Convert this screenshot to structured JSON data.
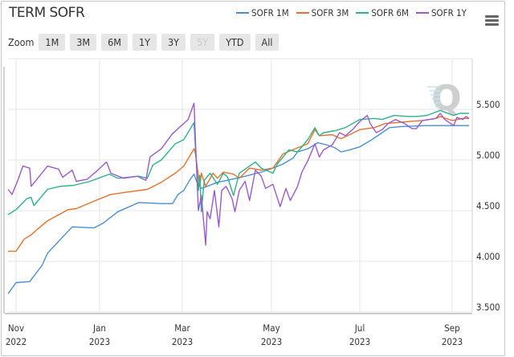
{
  "chart_data": {
    "type": "line",
    "title": "TERM SOFR",
    "watermark": "Q",
    "ylim": [
      3.5,
      6.0
    ],
    "y_ticks": [
      "3.500",
      "4.000",
      "4.500",
      "5.000",
      "5.500"
    ],
    "y_tick_values": [
      3.5,
      4.0,
      4.5,
      5.0,
      5.5
    ],
    "x_ticks": [
      {
        "date": "2022-11-01",
        "month": "Nov",
        "year": "2022"
      },
      {
        "date": "2023-01-01",
        "month": "Jan",
        "year": "2023"
      },
      {
        "date": "2023-03-01",
        "month": "Mar",
        "year": "2023"
      },
      {
        "date": "2023-05-01",
        "month": "May",
        "year": "2023"
      },
      {
        "date": "2023-07-01",
        "month": "Jul",
        "year": "2023"
      },
      {
        "date": "2023-09-01",
        "month": "Sep",
        "year": "2023"
      }
    ],
    "grid": true,
    "legend_position": "top-right",
    "series": [
      {
        "name": "SOFR 1M",
        "color": "#4a8fd6",
        "points": [
          [
            "2022-10-26",
            3.68
          ],
          [
            "2022-11-01",
            3.79
          ],
          [
            "2022-11-11",
            3.8
          ],
          [
            "2022-11-20",
            3.96
          ],
          [
            "2022-11-24",
            4.08
          ],
          [
            "2022-12-05",
            4.24
          ],
          [
            "2022-12-12",
            4.34
          ],
          [
            "2022-12-28",
            4.33
          ],
          [
            "2023-01-04",
            4.38
          ],
          [
            "2023-01-14",
            4.49
          ],
          [
            "2023-01-29",
            4.58
          ],
          [
            "2023-02-14",
            4.57
          ],
          [
            "2023-02-22",
            4.57
          ],
          [
            "2023-02-26",
            4.66
          ],
          [
            "2023-03-02",
            4.7
          ],
          [
            "2023-03-06",
            4.8
          ],
          [
            "2023-03-09",
            4.86
          ],
          [
            "2023-03-11",
            4.78
          ],
          [
            "2023-03-14",
            4.72
          ],
          [
            "2023-03-18",
            4.74
          ],
          [
            "2023-03-25",
            4.78
          ],
          [
            "2023-04-01",
            4.8
          ],
          [
            "2023-04-13",
            4.84
          ],
          [
            "2023-04-24",
            4.88
          ],
          [
            "2023-05-02",
            4.92
          ],
          [
            "2023-05-09",
            4.96
          ],
          [
            "2023-05-16",
            5.02
          ],
          [
            "2023-05-19",
            5.08
          ],
          [
            "2023-05-26",
            5.11
          ],
          [
            "2023-06-02",
            5.17
          ],
          [
            "2023-06-08",
            5.15
          ],
          [
            "2023-06-14",
            5.12
          ],
          [
            "2023-06-18",
            5.08
          ],
          [
            "2023-06-24",
            5.1
          ],
          [
            "2023-07-01",
            5.13
          ],
          [
            "2023-07-09",
            5.2
          ],
          [
            "2023-07-16",
            5.27
          ],
          [
            "2023-07-21",
            5.32
          ],
          [
            "2023-07-29",
            5.33
          ],
          [
            "2023-08-15",
            5.34
          ],
          [
            "2023-09-04",
            5.34
          ],
          [
            "2023-09-12",
            5.34
          ]
        ]
      },
      {
        "name": "SOFR 3M",
        "color": "#e8702a",
        "points": [
          [
            "2022-10-26",
            4.1
          ],
          [
            "2022-11-01",
            4.1
          ],
          [
            "2022-11-07",
            4.22
          ],
          [
            "2022-11-12",
            4.26
          ],
          [
            "2022-11-16",
            4.31
          ],
          [
            "2022-11-24",
            4.4
          ],
          [
            "2022-12-09",
            4.51
          ],
          [
            "2022-12-15",
            4.52
          ],
          [
            "2022-12-29",
            4.6
          ],
          [
            "2023-01-09",
            4.66
          ],
          [
            "2023-01-19",
            4.68
          ],
          [
            "2023-02-04",
            4.71
          ],
          [
            "2023-02-14",
            4.78
          ],
          [
            "2023-02-24",
            4.87
          ],
          [
            "2023-03-02",
            4.94
          ],
          [
            "2023-03-09",
            5.11
          ],
          [
            "2023-03-10",
            5.06
          ],
          [
            "2023-03-13",
            4.74
          ],
          [
            "2023-03-14",
            4.87
          ],
          [
            "2023-03-17",
            4.74
          ],
          [
            "2023-03-22",
            4.87
          ],
          [
            "2023-03-25",
            4.82
          ],
          [
            "2023-03-29",
            4.88
          ],
          [
            "2023-04-05",
            4.86
          ],
          [
            "2023-04-09",
            4.82
          ],
          [
            "2023-04-16",
            4.92
          ],
          [
            "2023-04-24",
            4.9
          ],
          [
            "2023-05-02",
            4.92
          ],
          [
            "2023-05-09",
            5.06
          ],
          [
            "2023-05-19",
            5.12
          ],
          [
            "2023-05-26",
            5.16
          ],
          [
            "2023-05-31",
            5.3
          ],
          [
            "2023-06-03",
            5.24
          ],
          [
            "2023-06-12",
            5.25
          ],
          [
            "2023-06-18",
            5.21
          ],
          [
            "2023-06-24",
            5.25
          ],
          [
            "2023-07-01",
            5.3
          ],
          [
            "2023-07-11",
            5.32
          ],
          [
            "2023-07-18",
            5.36
          ],
          [
            "2023-07-26",
            5.37
          ],
          [
            "2023-08-03",
            5.38
          ],
          [
            "2023-08-12",
            5.39
          ],
          [
            "2023-08-21",
            5.41
          ],
          [
            "2023-08-24",
            5.43
          ],
          [
            "2023-09-01",
            5.39
          ],
          [
            "2023-09-08",
            5.41
          ],
          [
            "2023-09-12",
            5.41
          ]
        ]
      },
      {
        "name": "SOFR 6M",
        "color": "#2bb38a",
        "points": [
          [
            "2022-10-26",
            4.46
          ],
          [
            "2022-11-01",
            4.51
          ],
          [
            "2022-11-09",
            4.62
          ],
          [
            "2022-11-12",
            4.63
          ],
          [
            "2022-11-14",
            4.55
          ],
          [
            "2022-11-24",
            4.71
          ],
          [
            "2022-12-03",
            4.74
          ],
          [
            "2022-12-13",
            4.75
          ],
          [
            "2022-12-25",
            4.79
          ],
          [
            "2023-01-08",
            4.86
          ],
          [
            "2023-01-14",
            4.82
          ],
          [
            "2023-01-29",
            4.84
          ],
          [
            "2023-02-04",
            4.82
          ],
          [
            "2023-02-08",
            4.95
          ],
          [
            "2023-02-14",
            5.0
          ],
          [
            "2023-02-24",
            5.16
          ],
          [
            "2023-03-02",
            5.2
          ],
          [
            "2023-03-09",
            5.37
          ],
          [
            "2023-03-10",
            5.11
          ],
          [
            "2023-03-12",
            4.7
          ],
          [
            "2023-03-13",
            4.85
          ],
          [
            "2023-03-14",
            4.49
          ],
          [
            "2023-03-16",
            4.8
          ],
          [
            "2023-03-20",
            4.87
          ],
          [
            "2023-03-25",
            4.76
          ],
          [
            "2023-03-29",
            4.87
          ],
          [
            "2023-04-01",
            4.83
          ],
          [
            "2023-04-05",
            4.65
          ],
          [
            "2023-04-09",
            4.87
          ],
          [
            "2023-04-14",
            4.92
          ],
          [
            "2023-04-20",
            4.98
          ],
          [
            "2023-04-24",
            4.92
          ],
          [
            "2023-05-02",
            4.87
          ],
          [
            "2023-05-05",
            4.96
          ],
          [
            "2023-05-13",
            5.1
          ],
          [
            "2023-05-19",
            5.08
          ],
          [
            "2023-05-26",
            5.2
          ],
          [
            "2023-05-31",
            5.32
          ],
          [
            "2023-06-03",
            5.24
          ],
          [
            "2023-06-06",
            5.27
          ],
          [
            "2023-06-14",
            5.29
          ],
          [
            "2023-06-21",
            5.32
          ],
          [
            "2023-07-01",
            5.4
          ],
          [
            "2023-07-11",
            5.41
          ],
          [
            "2023-07-16",
            5.4
          ],
          [
            "2023-07-24",
            5.44
          ],
          [
            "2023-08-02",
            5.43
          ],
          [
            "2023-08-08",
            5.43
          ],
          [
            "2023-08-15",
            5.44
          ],
          [
            "2023-08-24",
            5.49
          ],
          [
            "2023-09-02",
            5.44
          ],
          [
            "2023-09-06",
            5.46
          ],
          [
            "2023-09-12",
            5.46
          ]
        ]
      },
      {
        "name": "SOFR 1Y",
        "color": "#9b59d0",
        "points": [
          [
            "2022-10-26",
            4.71
          ],
          [
            "2022-10-29",
            4.66
          ],
          [
            "2022-11-02",
            4.79
          ],
          [
            "2022-11-06",
            4.94
          ],
          [
            "2022-11-11",
            4.92
          ],
          [
            "2022-11-12",
            4.74
          ],
          [
            "2022-11-18",
            4.84
          ],
          [
            "2022-11-24",
            4.94
          ],
          [
            "2022-12-02",
            4.91
          ],
          [
            "2022-12-05",
            4.83
          ],
          [
            "2022-12-12",
            4.9
          ],
          [
            "2022-12-15",
            4.79
          ],
          [
            "2022-12-23",
            4.81
          ],
          [
            "2022-12-29",
            4.88
          ],
          [
            "2023-01-06",
            4.98
          ],
          [
            "2023-01-09",
            4.87
          ],
          [
            "2023-01-18",
            4.82
          ],
          [
            "2023-01-28",
            4.84
          ],
          [
            "2023-02-03",
            4.8
          ],
          [
            "2023-02-06",
            5.03
          ],
          [
            "2023-02-14",
            5.11
          ],
          [
            "2023-02-22",
            5.26
          ],
          [
            "2023-03-05",
            5.4
          ],
          [
            "2023-03-09",
            5.56
          ],
          [
            "2023-03-10",
            5.19
          ],
          [
            "2023-03-12",
            4.5
          ],
          [
            "2023-03-14",
            4.65
          ],
          [
            "2023-03-17",
            4.16
          ],
          [
            "2023-03-18",
            4.49
          ],
          [
            "2023-03-20",
            4.42
          ],
          [
            "2023-03-23",
            4.7
          ],
          [
            "2023-03-26",
            4.34
          ],
          [
            "2023-03-28",
            4.7
          ],
          [
            "2023-03-31",
            4.74
          ],
          [
            "2023-04-04",
            4.62
          ],
          [
            "2023-04-06",
            4.49
          ],
          [
            "2023-04-09",
            4.7
          ],
          [
            "2023-04-13",
            4.79
          ],
          [
            "2023-04-16",
            4.6
          ],
          [
            "2023-04-20",
            4.9
          ],
          [
            "2023-04-24",
            4.84
          ],
          [
            "2023-04-27",
            4.72
          ],
          [
            "2023-05-02",
            4.76
          ],
          [
            "2023-05-07",
            4.54
          ],
          [
            "2023-05-11",
            4.72
          ],
          [
            "2023-05-14",
            4.6
          ],
          [
            "2023-05-19",
            4.74
          ],
          [
            "2023-05-22",
            4.88
          ],
          [
            "2023-05-26",
            4.99
          ],
          [
            "2023-05-31",
            5.16
          ],
          [
            "2023-06-03",
            5.03
          ],
          [
            "2023-06-06",
            5.1
          ],
          [
            "2023-06-12",
            5.15
          ],
          [
            "2023-06-17",
            5.27
          ],
          [
            "2023-06-21",
            5.24
          ],
          [
            "2023-06-26",
            5.3
          ],
          [
            "2023-07-01",
            5.38
          ],
          [
            "2023-07-06",
            5.44
          ],
          [
            "2023-07-08",
            5.36
          ],
          [
            "2023-07-12",
            5.27
          ],
          [
            "2023-07-16",
            5.3
          ],
          [
            "2023-07-20",
            5.36
          ],
          [
            "2023-07-25",
            5.4
          ],
          [
            "2023-07-31",
            5.36
          ],
          [
            "2023-08-05",
            5.31
          ],
          [
            "2023-08-08",
            5.31
          ],
          [
            "2023-08-12",
            5.39
          ],
          [
            "2023-08-17",
            5.4
          ],
          [
            "2023-08-21",
            5.41
          ],
          [
            "2023-08-24",
            5.46
          ],
          [
            "2023-08-27",
            5.4
          ],
          [
            "2023-09-02",
            5.34
          ],
          [
            "2023-09-04",
            5.42
          ],
          [
            "2023-09-08",
            5.4
          ],
          [
            "2023-09-10",
            5.43
          ],
          [
            "2023-09-12",
            5.41
          ]
        ]
      }
    ]
  },
  "toolbar": {
    "zoom_label": "Zoom",
    "buttons": [
      {
        "label": "1M",
        "enabled": true
      },
      {
        "label": "3M",
        "enabled": true
      },
      {
        "label": "6M",
        "enabled": true
      },
      {
        "label": "1Y",
        "enabled": true
      },
      {
        "label": "3Y",
        "enabled": true
      },
      {
        "label": "5Y",
        "enabled": false
      },
      {
        "label": "YTD",
        "enabled": true
      },
      {
        "label": "All",
        "enabled": true
      }
    ],
    "menu_icon": "hamburger-menu-icon"
  }
}
